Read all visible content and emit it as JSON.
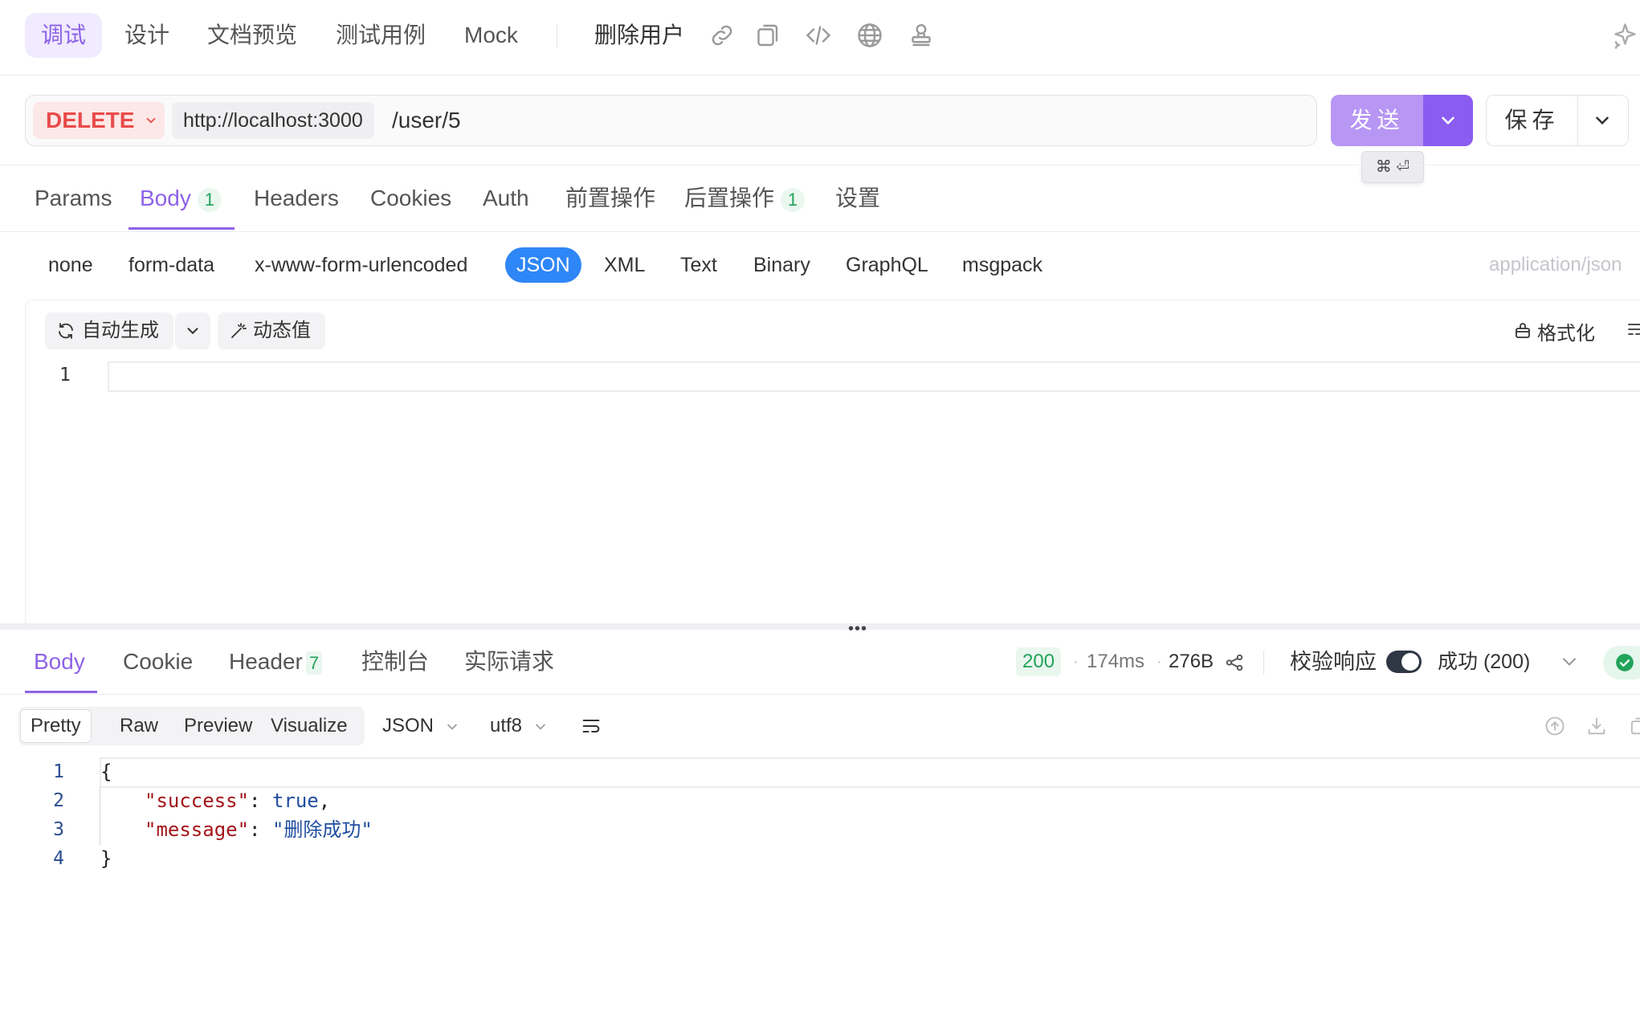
{
  "top_tabs": [
    "调试",
    "设计",
    "文档预览",
    "测试用例",
    "Mock"
  ],
  "api_name": "删除用户",
  "icons": {
    "link": "link-icon",
    "copy": "copy-icon",
    "code": "code-icon",
    "globe": "globe-icon",
    "stamp": "stamp-icon",
    "ai": "sparkle-icon"
  },
  "request": {
    "method": "DELETE",
    "base_url": "http://localhost:3000",
    "path": "/user/5",
    "send_label": "发送",
    "save_label": "保存",
    "shortcut": "⌘ ⏎"
  },
  "request_tabs": [
    {
      "label": "Params",
      "badge": ""
    },
    {
      "label": "Body",
      "badge": "1"
    },
    {
      "label": "Headers",
      "badge": ""
    },
    {
      "label": "Cookies",
      "badge": ""
    },
    {
      "label": "Auth",
      "badge": ""
    },
    {
      "label": "前置操作",
      "badge": ""
    },
    {
      "label": "后置操作",
      "badge": "1"
    },
    {
      "label": "设置",
      "badge": ""
    }
  ],
  "body_types": [
    "none",
    "form-data",
    "x-www-form-urlencoded",
    "JSON",
    "XML",
    "Text",
    "Binary",
    "GraphQL",
    "msgpack"
  ],
  "active_body_type": "JSON",
  "content_type": "application/json",
  "editor": {
    "auto_generate": "自动生成",
    "dynamic_value": "动态值",
    "format": "格式化",
    "line_numbers": [
      "1"
    ]
  },
  "response_tabs": [
    {
      "label": "Body",
      "badge": ""
    },
    {
      "label": "Cookie",
      "badge": ""
    },
    {
      "label": "Header",
      "badge": "7"
    },
    {
      "label": "控制台",
      "badge": ""
    },
    {
      "label": "实际请求",
      "badge": ""
    }
  ],
  "response_meta": {
    "status": "200",
    "time": "174ms",
    "size": "276B",
    "validate_label": "校验响应",
    "validate_on": true,
    "result": "成功 (200)"
  },
  "response_views": [
    "Pretty",
    "Raw",
    "Preview",
    "Visualize"
  ],
  "response_format": "JSON",
  "response_encoding": "utf8",
  "response_body": {
    "line_numbers": [
      "1",
      "2",
      "3",
      "4"
    ],
    "open": "{",
    "close": "}",
    "success_key": "\"success\"",
    "success_value": "true",
    "message_key": "\"message\"",
    "message_value": "\"删除成功\""
  },
  "colors": {
    "accent": "#8e63e8",
    "send": "#b796f4",
    "method": "#e94b4b",
    "json_active": "#2f86f6",
    "success": "#22a35a"
  }
}
